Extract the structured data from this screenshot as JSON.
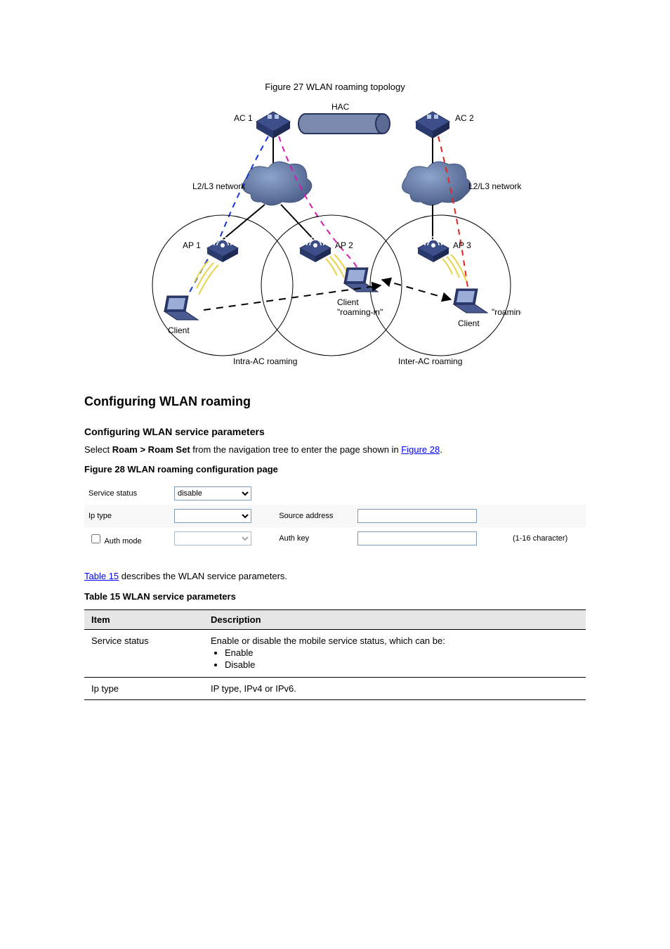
{
  "figure27": {
    "caption": "Figure 27 WLAN roaming topology",
    "labels": {
      "ac1": "AC 1",
      "hac": "HAC",
      "ac2": "AC 2",
      "l2l3": "L2/L3 network",
      "ap1": "AP 1",
      "ap2": "AP 2",
      "ap3": "AP 3",
      "client": "Client",
      "roaming_in": "\"roaming-in\"",
      "roaming_out": "\"roaming-out\"",
      "intraAC": "Intra-AC roaming",
      "interAC": "Inter-AC roaming"
    }
  },
  "roaming_section_title": "Configuring WLAN roaming",
  "svc_section_title": "Configuring WLAN service parameters",
  "nav_path_prefix": "Select ",
  "nav_path_bold": "Roam > Roam Set",
  "nav_path_suffix": " from the navigation tree to enter the page shown in ",
  "nav_path_ref": "Figure 28",
  "figure28_caption": "Figure 28 WLAN roaming configuration page",
  "wlan_form": {
    "service_status": {
      "label": "Service status",
      "value": "disable"
    },
    "ip_type": {
      "label": "Ip type",
      "value": ""
    },
    "source_address": {
      "label": "Source address"
    },
    "auth_mode": {
      "label": "Auth mode"
    },
    "auth_key": {
      "label": "Auth key",
      "hint": "(1-16 character)"
    }
  },
  "table15": {
    "ref": "Table 15",
    "caption_rest": " describes the WLAN service parameters.",
    "title": "Table 15 WLAN service parameters",
    "col1": "Item",
    "col2": "Description",
    "rows": [
      {
        "item": "Service status",
        "desc_intro": "Enable or disable the mobile service status, which can be:",
        "bullets": [
          "Enable",
          "Disable"
        ]
      },
      {
        "item": "Ip type",
        "desc_intro": "IP type, IPv4 or IPv6.",
        "bullets": []
      }
    ]
  }
}
